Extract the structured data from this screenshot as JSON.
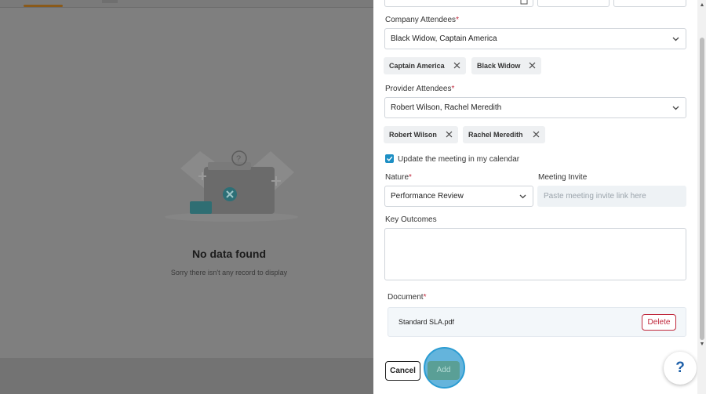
{
  "background": {
    "empty_title": "No data found",
    "empty_subtitle": "Sorry there isn't any record to display"
  },
  "form": {
    "company_attendees": {
      "label": "Company Attendees",
      "value": "Black Widow, Captain America",
      "chips": [
        "Captain America",
        "Black Widow"
      ]
    },
    "provider_attendees": {
      "label": "Provider Attendees",
      "value": "Robert Wilson, Rachel Meredith",
      "chips": [
        "Robert Wilson",
        "Rachel Meredith"
      ]
    },
    "calendar_checkbox": {
      "label": "Update the meeting in my calendar",
      "checked": true
    },
    "nature": {
      "label": "Nature",
      "value": "Performance Review"
    },
    "meeting_invite": {
      "label": "Meeting Invite",
      "placeholder": "Paste meeting invite link here"
    },
    "key_outcomes": {
      "label": "Key Outcomes",
      "value": ""
    },
    "document": {
      "label": "Document",
      "file_name": "Standard SLA.pdf",
      "delete_label": "Delete"
    },
    "required_marker": "*"
  },
  "actions": {
    "cancel_label": "Cancel",
    "add_label": "Add"
  },
  "help": {
    "label": "?"
  },
  "colors": {
    "accent": "#1d8fc4",
    "danger": "#c0283c",
    "add_button": "#5a9f96",
    "focus_ring": "#2b9cd2"
  }
}
